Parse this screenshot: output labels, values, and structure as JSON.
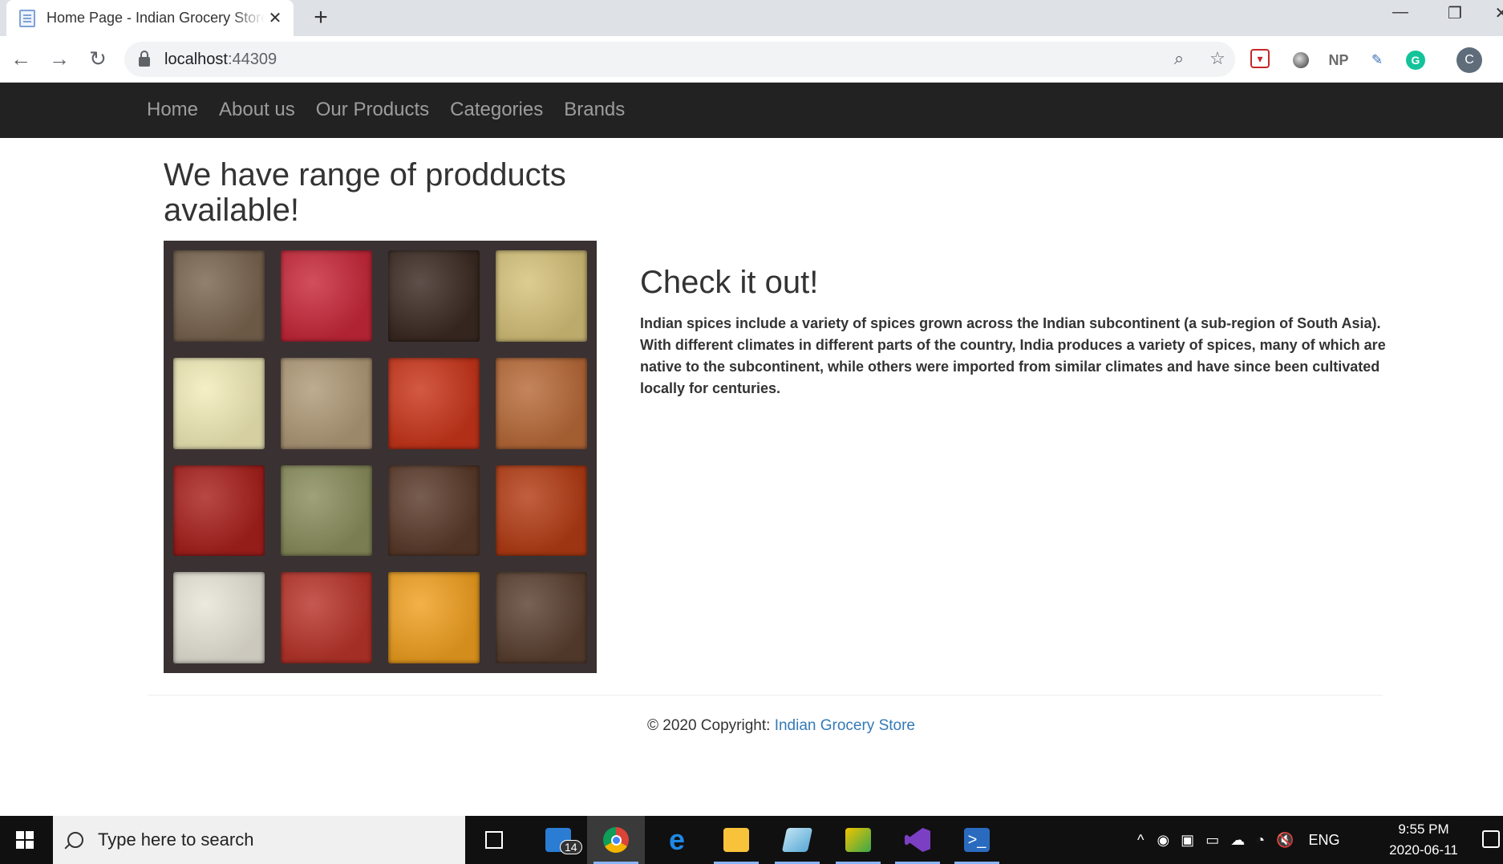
{
  "browser": {
    "tab_title": "Home Page - Indian Grocery Store",
    "url_host": "localhost",
    "url_port": ":44309",
    "new_tab_label": "+",
    "close_tab_label": "✕",
    "window_controls": [
      "—",
      "❐",
      "✕"
    ],
    "extensions": [
      "shield-icon",
      "circle-icon",
      "np-icon",
      "dropper-icon",
      "grammarly-icon"
    ],
    "extension_np_label": "NP",
    "grammarly_label": "G",
    "profile_initial": "C"
  },
  "nav": {
    "items": [
      "Home",
      "About us",
      "Our Products",
      "Categories",
      "Brands"
    ]
  },
  "main": {
    "heading": "We have range of prodducts available!",
    "check_title": "Check it out!",
    "check_text": "Indian spices include a variety of spices grown across the Indian subcontinent (a sub-region of South Asia). With different climates in different parts of the country, India produces a variety of spices, many of which are native to the subcontinent, while others were imported from similar climates and have since been cultivated locally for centuries.",
    "spice_colors": [
      "#7a6550",
      "#c8283a",
      "#3b2a22",
      "#d6c27a",
      "#f2ecb8",
      "#b09a78",
      "#c9351a",
      "#b86a38",
      "#a8201c",
      "#8a8e5c",
      "#5a3a2a",
      "#b43c14",
      "#e8e4d8",
      "#b8342a",
      "#f0a020",
      "#5a4030"
    ]
  },
  "footer": {
    "copyright": "© 2020 Copyright:",
    "link": "Indian Grocery Store"
  },
  "taskbar": {
    "search_placeholder": "Type here to search",
    "mail_badge": "14",
    "tray_language": "ENG",
    "time": "9:55 PM",
    "date": "2020-06-11"
  }
}
